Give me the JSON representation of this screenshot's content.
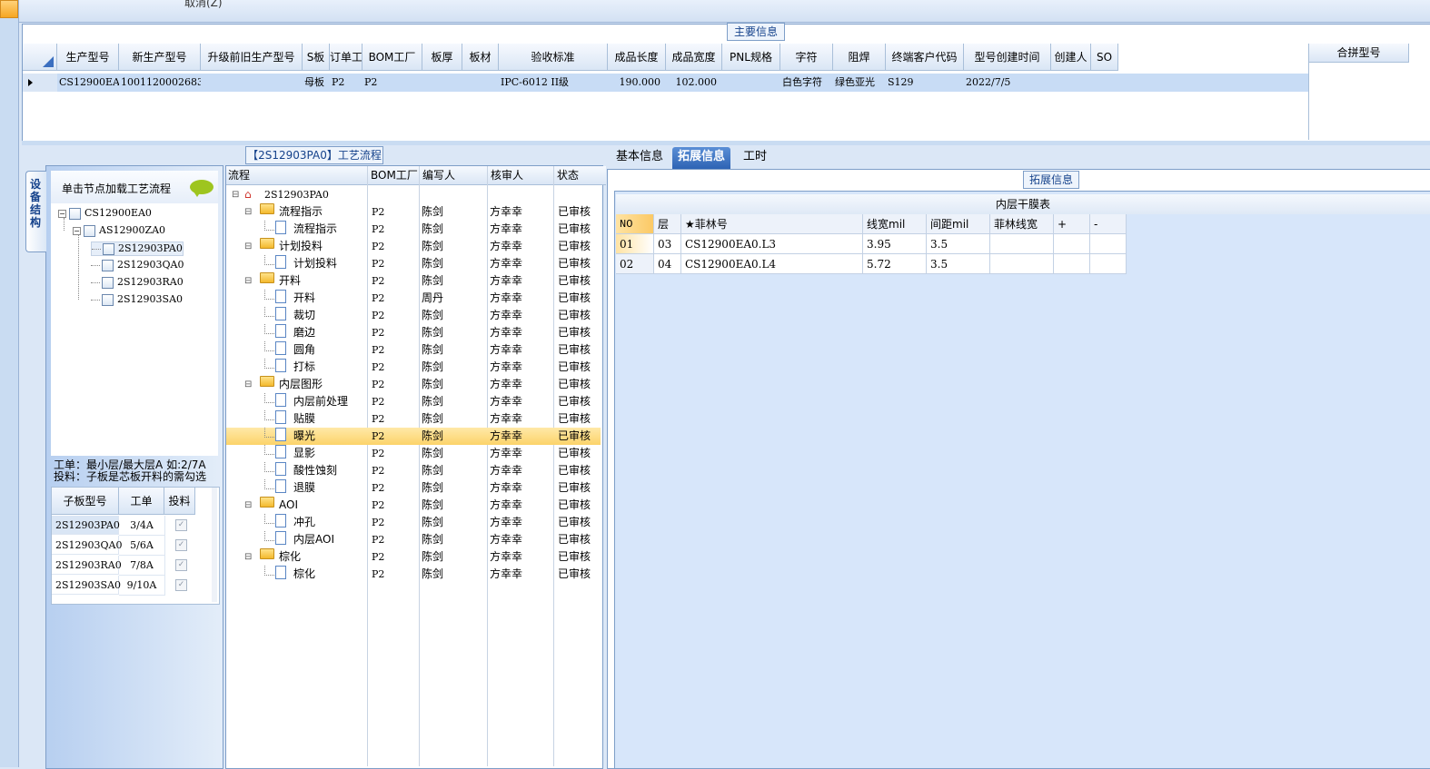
{
  "toolbar": {
    "cancel_label": "取消(Z)"
  },
  "main_info": {
    "title": "主要信息",
    "columns": [
      "生产型号",
      "新生产型号",
      "升级前旧生产型号",
      "S板",
      "订单工厂",
      "BOM工厂",
      "板厚",
      "板材",
      "验收标准",
      "成品长度",
      "成品宽度",
      "PNL规格",
      "字符",
      "阻焊",
      "终端客户代码",
      "型号创建时间",
      "创建人",
      "SO"
    ],
    "row": [
      "CS12900EA0",
      "10011200026833",
      "",
      "母板",
      "P2",
      "P2",
      "",
      "",
      "IPC-6012 II级",
      "190.000",
      "102.000",
      "",
      "白色字符",
      "绿色亚光",
      "S129",
      "2022/7/5",
      "",
      ""
    ],
    "side_column": "合拼型号"
  },
  "left_panel": {
    "vertical_tab": "设备结构",
    "load_hint": "单击节点加载工艺流程",
    "tree": [
      {
        "label": "CS12900EA0"
      },
      {
        "label": "AS12900ZA0"
      },
      {
        "label": "2S12903PA0"
      },
      {
        "label": "2S12903QA0"
      },
      {
        "label": "2S12903RA0"
      },
      {
        "label": "2S12903SA0"
      }
    ],
    "note_line1": "工单：最小层/最大层A 如:2/7A",
    "note_line2": "投料：子板是芯板开料的需勾选",
    "sub_grid": {
      "headers": [
        "子板型号",
        "工单",
        "投料"
      ],
      "rows": [
        {
          "model": "2S12903PA0",
          "order": "3/4A"
        },
        {
          "model": "2S12903QA0",
          "order": "5/6A"
        },
        {
          "model": "2S12903RA0",
          "order": "7/8A"
        },
        {
          "model": "2S12903SA0",
          "order": "9/10A"
        }
      ]
    }
  },
  "process": {
    "title": "【2S12903PA0】工艺流程",
    "headers": [
      "流程",
      "BOM工厂",
      "编写人",
      "核审人",
      "状态"
    ],
    "root": "2S12903PA0",
    "rows": [
      {
        "name": "流程指示",
        "level": 1,
        "factory": "P2",
        "writer": "陈剑",
        "reviewer": "方幸幸",
        "status": "已审核"
      },
      {
        "name": "流程指示",
        "level": 2,
        "factory": "P2",
        "writer": "陈剑",
        "reviewer": "方幸幸",
        "status": "已审核"
      },
      {
        "name": "计划投料",
        "level": 1,
        "factory": "P2",
        "writer": "陈剑",
        "reviewer": "方幸幸",
        "status": "已审核"
      },
      {
        "name": "计划投料",
        "level": 2,
        "factory": "P2",
        "writer": "陈剑",
        "reviewer": "方幸幸",
        "status": "已审核"
      },
      {
        "name": "开料",
        "level": 1,
        "factory": "P2",
        "writer": "陈剑",
        "reviewer": "方幸幸",
        "status": "已审核"
      },
      {
        "name": "开料",
        "level": 2,
        "factory": "P2",
        "writer": "周丹",
        "reviewer": "方幸幸",
        "status": "已审核"
      },
      {
        "name": "裁切",
        "level": 2,
        "factory": "P2",
        "writer": "陈剑",
        "reviewer": "方幸幸",
        "status": "已审核"
      },
      {
        "name": "磨边",
        "level": 2,
        "factory": "P2",
        "writer": "陈剑",
        "reviewer": "方幸幸",
        "status": "已审核"
      },
      {
        "name": "圆角",
        "level": 2,
        "factory": "P2",
        "writer": "陈剑",
        "reviewer": "方幸幸",
        "status": "已审核"
      },
      {
        "name": "打标",
        "level": 2,
        "factory": "P2",
        "writer": "陈剑",
        "reviewer": "方幸幸",
        "status": "已审核"
      },
      {
        "name": "内层图形",
        "level": 1,
        "factory": "P2",
        "writer": "陈剑",
        "reviewer": "方幸幸",
        "status": "已审核"
      },
      {
        "name": "内层前处理",
        "level": 2,
        "factory": "P2",
        "writer": "陈剑",
        "reviewer": "方幸幸",
        "status": "已审核"
      },
      {
        "name": "贴膜",
        "level": 2,
        "factory": "P2",
        "writer": "陈剑",
        "reviewer": "方幸幸",
        "status": "已审核"
      },
      {
        "name": "曝光",
        "level": 2,
        "factory": "P2",
        "writer": "陈剑",
        "reviewer": "方幸幸",
        "status": "已审核",
        "selected": true
      },
      {
        "name": "显影",
        "level": 2,
        "factory": "P2",
        "writer": "陈剑",
        "reviewer": "方幸幸",
        "status": "已审核"
      },
      {
        "name": "酸性蚀刻",
        "level": 2,
        "factory": "P2",
        "writer": "陈剑",
        "reviewer": "方幸幸",
        "status": "已审核"
      },
      {
        "name": "退膜",
        "level": 2,
        "factory": "P2",
        "writer": "陈剑",
        "reviewer": "方幸幸",
        "status": "已审核"
      },
      {
        "name": "AOI",
        "level": 1,
        "factory": "P2",
        "writer": "陈剑",
        "reviewer": "方幸幸",
        "status": "已审核"
      },
      {
        "name": "冲孔",
        "level": 2,
        "factory": "P2",
        "writer": "陈剑",
        "reviewer": "方幸幸",
        "status": "已审核"
      },
      {
        "name": "内层AOI",
        "level": 2,
        "factory": "P2",
        "writer": "陈剑",
        "reviewer": "方幸幸",
        "status": "已审核"
      },
      {
        "name": "棕化",
        "level": 1,
        "factory": "P2",
        "writer": "陈剑",
        "reviewer": "方幸幸",
        "status": "已审核"
      },
      {
        "name": "棕化",
        "level": 2,
        "factory": "P2",
        "writer": "陈剑",
        "reviewer": "方幸幸",
        "status": "已审核"
      }
    ]
  },
  "right": {
    "tabs": [
      "基本信息",
      "拓展信息",
      "工时"
    ],
    "active_tab": "拓展信息",
    "section_title": "拓展信息",
    "table_title": "内层干膜表",
    "headers": [
      "NO",
      "层",
      "★菲林号",
      "线宽mil",
      "间距mil",
      "菲林线宽",
      "+",
      "-"
    ],
    "rows": [
      [
        "01",
        "03",
        "CS12900EA0.L3",
        "3.95",
        "3.5",
        "",
        "",
        ""
      ],
      [
        "02",
        "04",
        "CS12900EA0.L4",
        "5.72",
        "3.5",
        "",
        "",
        ""
      ]
    ]
  }
}
